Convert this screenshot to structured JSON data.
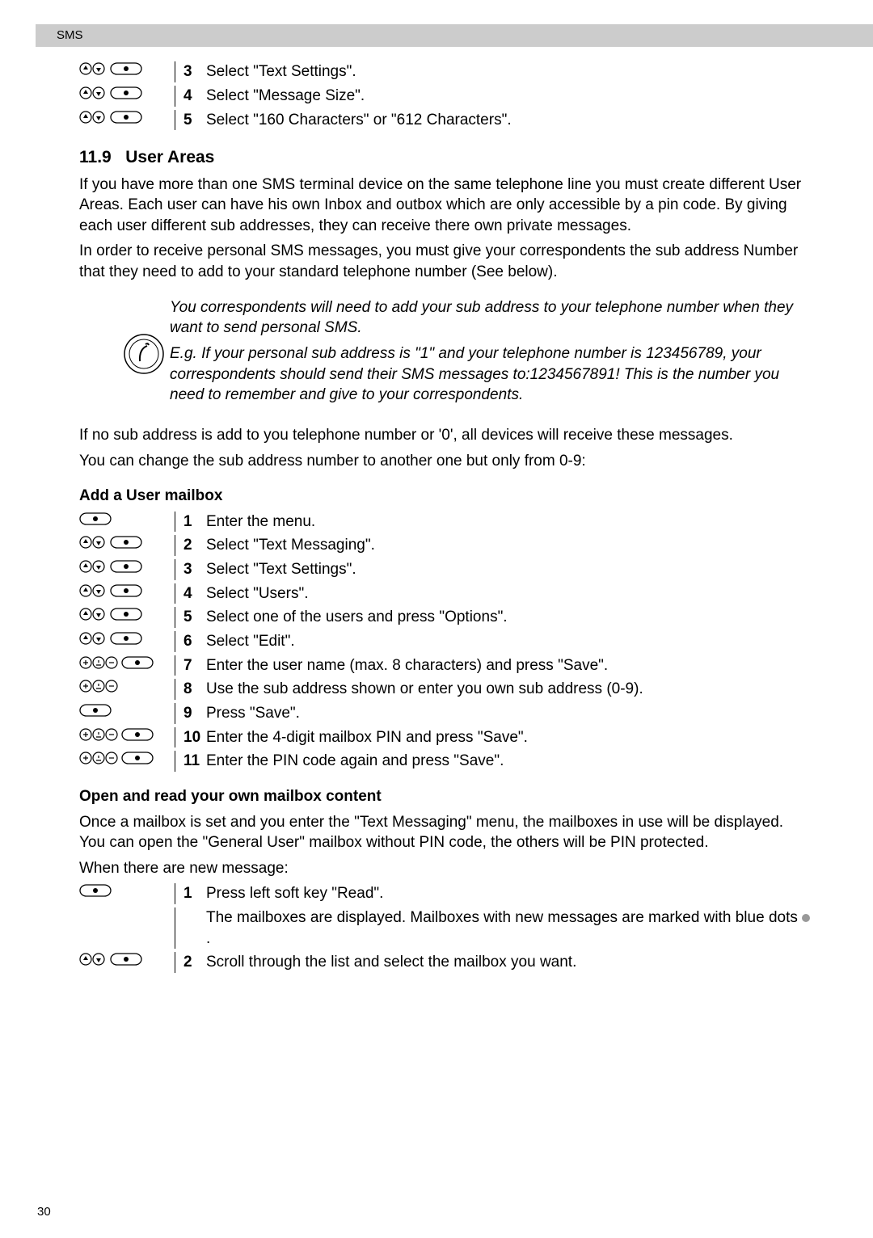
{
  "header": {
    "section": "SMS"
  },
  "top_steps": [
    {
      "n": "3",
      "text": "Select \"Text Settings\"."
    },
    {
      "n": "4",
      "text": "Select \"Message Size\"."
    },
    {
      "n": "5",
      "text": "Select \"160 Characters\" or \"612 Characters\"."
    }
  ],
  "section_11_9": {
    "heading_num": "11.9",
    "heading_text": "User Areas",
    "para1": "If you have more than one SMS terminal device on the same telephone line you must create different User Areas. Each user can have his own Inbox and outbox which are only accessible by a pin code. By giving each user different sub addresses, they can receive there own private messages.",
    "para2": "In order to receive personal SMS messages, you must give your correspondents the sub address Number that they need to add to your standard telephone number (See below).",
    "note1": "You correspondents will need to add your sub address to your telephone number when they want to send personal SMS.",
    "note2": "E.g. If your personal sub address is \"1\" and your telephone number is 123456789, your correspondents should send their SMS messages to:1234567891! This is the number you need to remember and give to your correspondents.",
    "para3": "If no sub address is add to you telephone number or '0', all devices will receive these messages.",
    "para4": "You can change the sub address number to another one but only from 0-9:"
  },
  "add_user": {
    "heading": "Add a User mailbox",
    "steps": [
      {
        "n": "1",
        "text": "Enter the menu."
      },
      {
        "n": "2",
        "text": "Select \"Text Messaging\"."
      },
      {
        "n": "3",
        "text": "Select \"Text Settings\"."
      },
      {
        "n": "4",
        "text": "Select \"Users\"."
      },
      {
        "n": "5",
        "text": "Select one of the users and press \"Options\"."
      },
      {
        "n": "6",
        "text": "Select \"Edit\"."
      },
      {
        "n": "7",
        "text": "Enter the user name (max. 8 characters) and press \"Save\"."
      },
      {
        "n": "8",
        "text": "Use the sub address shown or enter you own sub address (0-9)."
      },
      {
        "n": "9",
        "text": "Press \"Save\"."
      },
      {
        "n": "10",
        "text": "Enter the 4-digit mailbox PIN and press \"Save\"."
      },
      {
        "n": "11",
        "text": "Enter the PIN code again and press \"Save\"."
      }
    ]
  },
  "open_read": {
    "heading": "Open and read your own mailbox content",
    "para1": "Once a mailbox is set and you enter the \"Text Messaging\" menu, the mailboxes in use will be displayed. You can open the \"General User\" mailbox without PIN code, the others will be PIN protected.",
    "para2": "When there are new message:",
    "step1_n": "1",
    "step1_text": "Press left soft key \"Read\".",
    "step1_extra_a": "The mailboxes are displayed. Mailboxes with new messages are marked with blue dots ",
    "step1_extra_b": ".",
    "step2_n": "2",
    "step2_text": "Scroll through the list and select the mailbox you want."
  },
  "page_number": "30"
}
